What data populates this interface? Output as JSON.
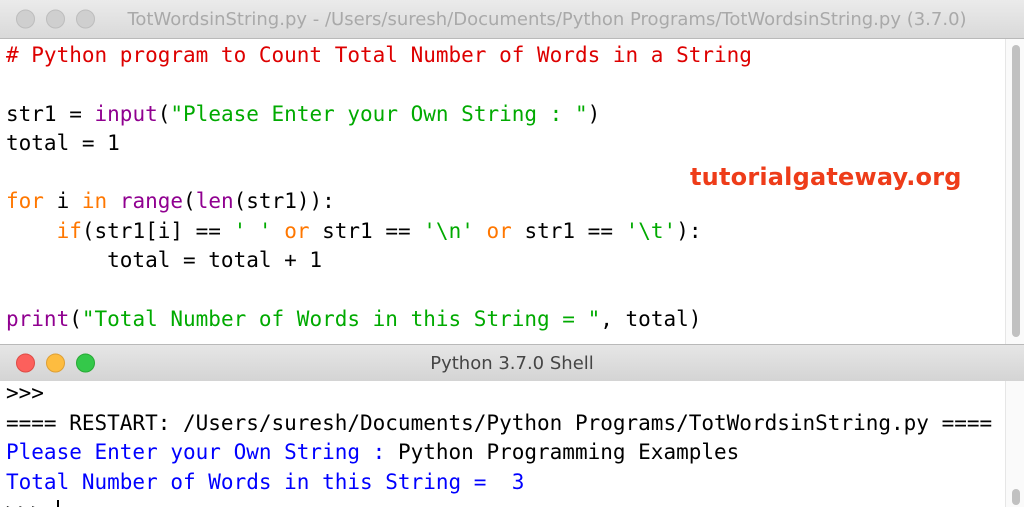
{
  "editor_window": {
    "title": "TotWordsinString.py - /Users/suresh/Documents/Python Programs/TotWordsinString.py (3.7.0)",
    "code": {
      "comment": "# Python program to Count Total Number of Words in a String",
      "l3_a": "str1 = ",
      "l3_b": "input",
      "l3_c": "(",
      "l3_d": "\"Please Enter your Own String : \"",
      "l3_e": ")",
      "l4": "total = 1",
      "l6_kw1": "for",
      "l6_b": " i ",
      "l6_kw2": "in",
      "l6_c": " ",
      "l6_d": "range",
      "l6_e": "(",
      "l6_f": "len",
      "l6_g": "(str1)):",
      "l7_indent": "    ",
      "l7_kw": "if",
      "l7_b": "(str1[i] == ",
      "l7_s1": "' '",
      "l7_c": " ",
      "l7_or1": "or",
      "l7_d": " str1 == ",
      "l7_s2": "'\\n'",
      "l7_e": " ",
      "l7_or2": "or",
      "l7_f": " str1 == ",
      "l7_s3": "'\\t'",
      "l7_g": "):",
      "l8": "        total = total + 1",
      "l10_a": "print",
      "l10_b": "(",
      "l10_c": "\"Total Number of Words in this String = \"",
      "l10_d": ", total)"
    },
    "watermark": "tutorialgateway.org"
  },
  "shell_window": {
    "title": "Python 3.7.0 Shell",
    "lines": {
      "prompt_prev": ">>>",
      "restart": "==== RESTART: /Users/suresh/Documents/Python Programs/TotWordsinString.py ====",
      "input_prompt": "Please Enter your Own String : ",
      "input_value": "Python Programming Examples",
      "output": "Total Number of Words in this String =  3",
      "prompt": ">>> "
    }
  },
  "colors": {
    "comment": "#dd0000",
    "keyword": "#ff7700",
    "builtin": "#900090",
    "string": "#00aa00",
    "stdout": "#0000ff",
    "watermark": "#ee3c19"
  }
}
